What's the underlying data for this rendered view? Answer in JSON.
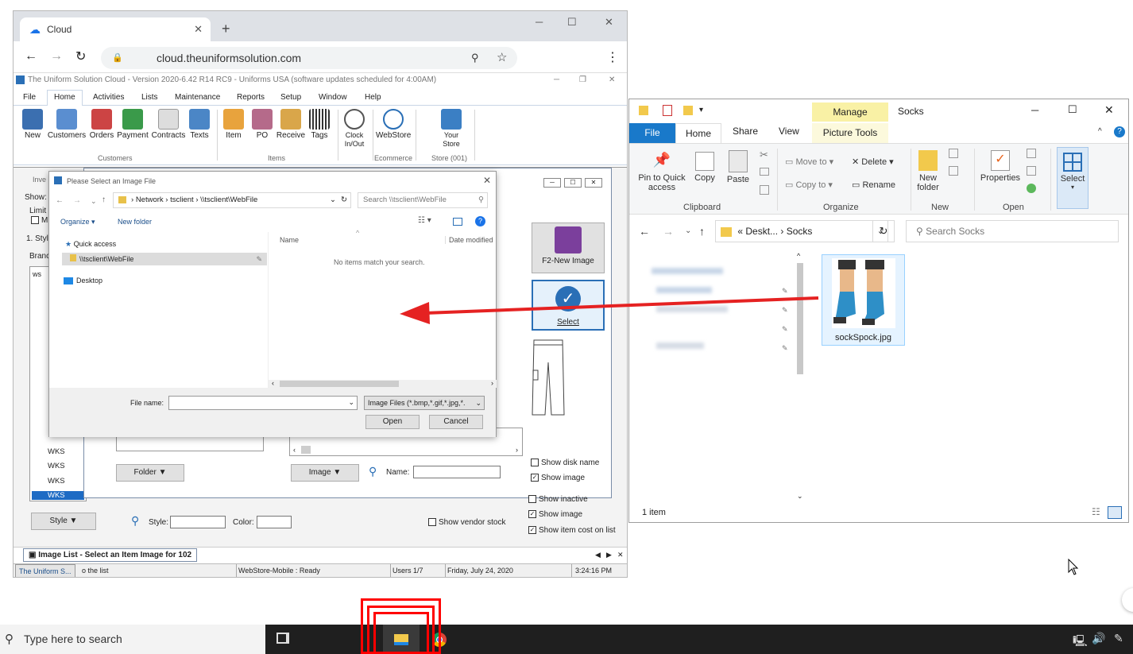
{
  "chrome": {
    "tab_title": "Cloud",
    "url": "cloud.theuniformsolution.com",
    "new_tab": "+",
    "minimize": "─",
    "maximize": "☐",
    "close": "✕"
  },
  "app": {
    "title": "The Uniform Solution Cloud - Version 2020-6.42 R14 RC9 - Uniforms USA (software updates scheduled for 4:00AM)",
    "menu": [
      "File",
      "Home",
      "Activities",
      "Lists",
      "Maintenance",
      "Reports",
      "Setup",
      "Window",
      "Help"
    ],
    "ribbon": {
      "buttons": [
        "New",
        "Customers",
        "Orders",
        "Payment",
        "Contracts",
        "Texts",
        "Item",
        "PO",
        "Receive",
        "Tags",
        "Clock In/Out",
        "WebStore",
        "Your Store"
      ],
      "groups": [
        "Customers",
        "Items",
        "Ecommerce",
        "Store (001)"
      ]
    }
  },
  "inventory": {
    "title_fragment": "Inve",
    "labels": {
      "show": "Show:",
      "limit": "Limit",
      "mi": "Mi",
      "style": "1. Style",
      "brand": "Branc",
      "ws_header": "ws"
    },
    "rows": [
      "WKS",
      "WKS",
      "WKS",
      "WKS"
    ],
    "bottom": {
      "style_dropdown": "Style",
      "style_label": "Style:",
      "color_label": "Color:",
      "show_vendor_stock": "Show vendor stock",
      "show_inactive": "Show inactive",
      "show_image": "Show image",
      "show_item_cost": "Show item cost on list"
    },
    "tab_label": "Image List - Select an Item Image for 102"
  },
  "image_list": {
    "f2_new_image": "F2-New Image",
    "select": "Select",
    "folder_btn": "Folder",
    "image_btn": "Image",
    "name_label": "Name:",
    "show_disk_name": "Show disk name",
    "show_image": "Show image"
  },
  "dialog": {
    "title": "Please Select an Image File",
    "breadcrumb": [
      "Network",
      "tsclient",
      "\\\\tsclient\\WebFile"
    ],
    "search_placeholder": "Search \\\\tsclient\\WebFile",
    "organize": "Organize ▾",
    "new_folder": "New folder",
    "nav": {
      "quick_access": "Quick access",
      "webfile": "\\\\tsclient\\WebFile",
      "desktop": "Desktop"
    },
    "col_name": "Name",
    "col_date": "Date modified",
    "empty": "No items match your search.",
    "file_name_label": "File name:",
    "file_type": "Image Files (*.bmp,*.gif,*.jpg,*.",
    "open": "Open",
    "cancel": "Cancel"
  },
  "status_bar": {
    "app": "The Uniform S...",
    "hint": "o the list",
    "webstore": "WebStore-Mobile : Ready",
    "users": "Users 1/7",
    "date": "Friday, July 24, 2020",
    "time": "3:24:16 PM"
  },
  "explorer": {
    "title": "Socks",
    "manage": "Manage",
    "tabs": [
      "File",
      "Home",
      "Share",
      "View",
      "Picture Tools"
    ],
    "buttons": {
      "pin": "Pin to Quick access",
      "copy": "Copy",
      "paste": "Paste",
      "move_to": "Move to ▾",
      "copy_to": "Copy to ▾",
      "delete": "Delete ▾",
      "rename": "Rename",
      "new_folder": "New folder",
      "properties": "Properties",
      "select": "Select"
    },
    "groups": [
      "Clipboard",
      "Organize",
      "New",
      "Open"
    ],
    "path": [
      "«",
      "Deskt...",
      "›",
      "Socks"
    ],
    "search_placeholder": "Search Socks",
    "file": "sockSpock.jpg",
    "status": "1 item"
  },
  "taskbar": {
    "search_placeholder": "Type here to search"
  },
  "colors": {
    "accent": "#1a73e8",
    "explorer_file_tab": "#1979ca",
    "manage_tab": "#f9f1a5",
    "arrow": "#e52222",
    "highlight_box": "#ff0000",
    "taskbar": "#1f1f1f"
  }
}
